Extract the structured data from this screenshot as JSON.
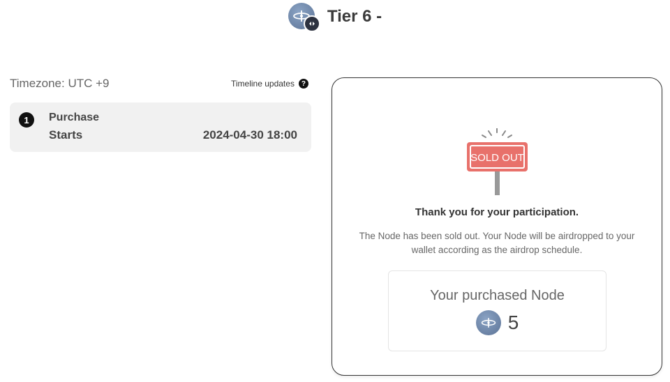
{
  "header": {
    "title": "Tier 6 -"
  },
  "timeline": {
    "timezone": "Timezone: UTC +9",
    "updates_label": "Timeline updates",
    "help_icon": "?",
    "steps": [
      {
        "number": "1",
        "label": "Purchase",
        "sub_label": "Starts",
        "date": "2024-04-30 18:00"
      }
    ]
  },
  "sold_out": {
    "sign_text": "SOLD OUT",
    "sign_color": "#e8716b",
    "thanks": "Thank you for your participation.",
    "message": "The Node has been sold out. Your Node will be airdropped to your wallet according as the airdrop schedule.",
    "purchased_title": "Your purchased Node",
    "purchased_count": "5"
  },
  "icons": {
    "logo": "node-logo-icon",
    "badge": "chain-badge-icon",
    "help": "help-icon",
    "sold_out_sign": "sold-out-sign-icon"
  }
}
